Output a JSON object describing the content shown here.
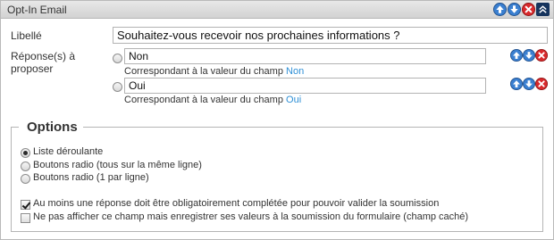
{
  "window": {
    "title": "Opt-In Email",
    "controls": [
      "move-up-icon",
      "move-down-icon",
      "delete-icon",
      "collapse-icon"
    ]
  },
  "field": {
    "label_caption": "Libellé",
    "label_value": "Souhaitez-vous recevoir nos prochaines informations ?",
    "answers_caption": "Réponse(s) à proposer"
  },
  "answers": [
    {
      "value": "Non",
      "hint_prefix": "Correspondant à la valeur du champ",
      "hint_value": "Non",
      "selected": false
    },
    {
      "value": "Oui",
      "hint_prefix": "Correspondant à la valeur du champ",
      "hint_value": "Oui",
      "selected": false
    }
  ],
  "options": {
    "legend": "Options",
    "display_modes": [
      {
        "label": "Liste déroulante",
        "selected": true
      },
      {
        "label": "Boutons radio (tous sur la même ligne)",
        "selected": false
      },
      {
        "label": "Boutons radio (1 par ligne)",
        "selected": false
      }
    ],
    "checkboxes": [
      {
        "label": "Au moins une réponse doit être obligatoirement complétée pour pouvoir valider la soumission",
        "checked": true
      },
      {
        "label": "Ne pas afficher ce champ mais enregistrer ses valeurs à la soumission du formulaire (champ caché)",
        "checked": false
      }
    ]
  },
  "colors": {
    "accent_blue": "#2e8fd6",
    "control_blue": "#3a7fd0",
    "control_red": "#d8292c",
    "control_navy": "#16345d"
  }
}
